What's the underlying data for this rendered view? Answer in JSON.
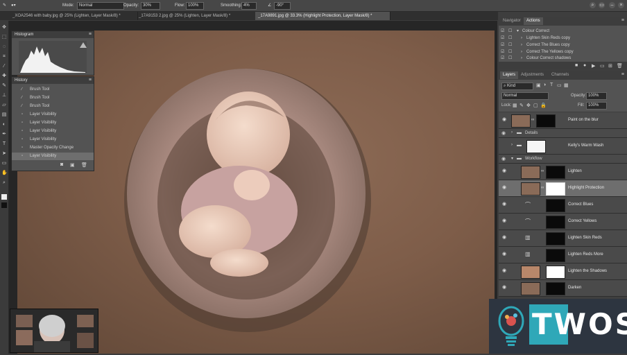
{
  "options_bar": {
    "mode_label": "Mode:",
    "mode_value": "Normal",
    "opacity_label": "Opacity:",
    "opacity_value": "30%",
    "flow_label": "Flow:",
    "flow_value": "100%",
    "smoothing_label": "Smoothing:",
    "smoothing_value": "4%",
    "angle_value": "-90°"
  },
  "tabs": [
    {
      "label": "_XOA2546 with baby.jpg @ 25% (Lighten, Layer Mask/8) *"
    },
    {
      "label": "_17A9153 2.jpg @ 25% (Lighten, Layer Mask/8) *"
    },
    {
      "label": "_17A9891.jpg @ 33.3% (Highlight Protection, Layer Mask/8) *"
    }
  ],
  "histogram": {
    "title": "Histogram"
  },
  "history": {
    "title": "History",
    "items": [
      "Brush Tool",
      "Brush Tool",
      "Brush Tool",
      "Layer Visibility",
      "Layer Visibility",
      "Layer Visibility",
      "Layer Visibility",
      "Master Opacity Change",
      "Layer Visibility"
    ]
  },
  "navigator": {
    "tab_navigator": "Navigator",
    "tab_actions": "Actions"
  },
  "actions": {
    "items": [
      "Colour Correct",
      "Lighten Skin Reds copy",
      "Correct The Blues copy",
      "Correct The Yellows copy",
      "Colour Correct shadows"
    ]
  },
  "layers_panel": {
    "tab_layers": "Layers",
    "tab_adjustments": "Adjustments",
    "tab_channels": "Channels",
    "kind_value": "Kind",
    "blend_value": "Normal",
    "opacity_label": "Opacity:",
    "opacity_value": "100%",
    "lock_label": "Lock:",
    "fill_label": "Fill:",
    "fill_value": "100%",
    "layers": [
      {
        "name": "Paint on the blur",
        "type": "layer"
      },
      {
        "name": "Details",
        "type": "group"
      },
      {
        "name": "Kelly's Warm Wash",
        "type": "layer"
      },
      {
        "name": "Workflow",
        "type": "group"
      },
      {
        "name": "Lighten",
        "type": "layer"
      },
      {
        "name": "Highlight Protection",
        "type": "layer"
      },
      {
        "name": "Correct Blues",
        "type": "layer"
      },
      {
        "name": "Correct Yellows",
        "type": "layer"
      },
      {
        "name": "Lighten Skin Reds",
        "type": "layer"
      },
      {
        "name": "Lighten Reds More",
        "type": "layer"
      },
      {
        "name": "Lighten the Shadows",
        "type": "layer"
      },
      {
        "name": "Darken",
        "type": "layer"
      }
    ]
  },
  "logo": {
    "text": "TWOS"
  },
  "colors": {
    "panel": "#535353",
    "selected_layer": "#6e6e6e",
    "logo_teal": "#2fa8b8"
  }
}
